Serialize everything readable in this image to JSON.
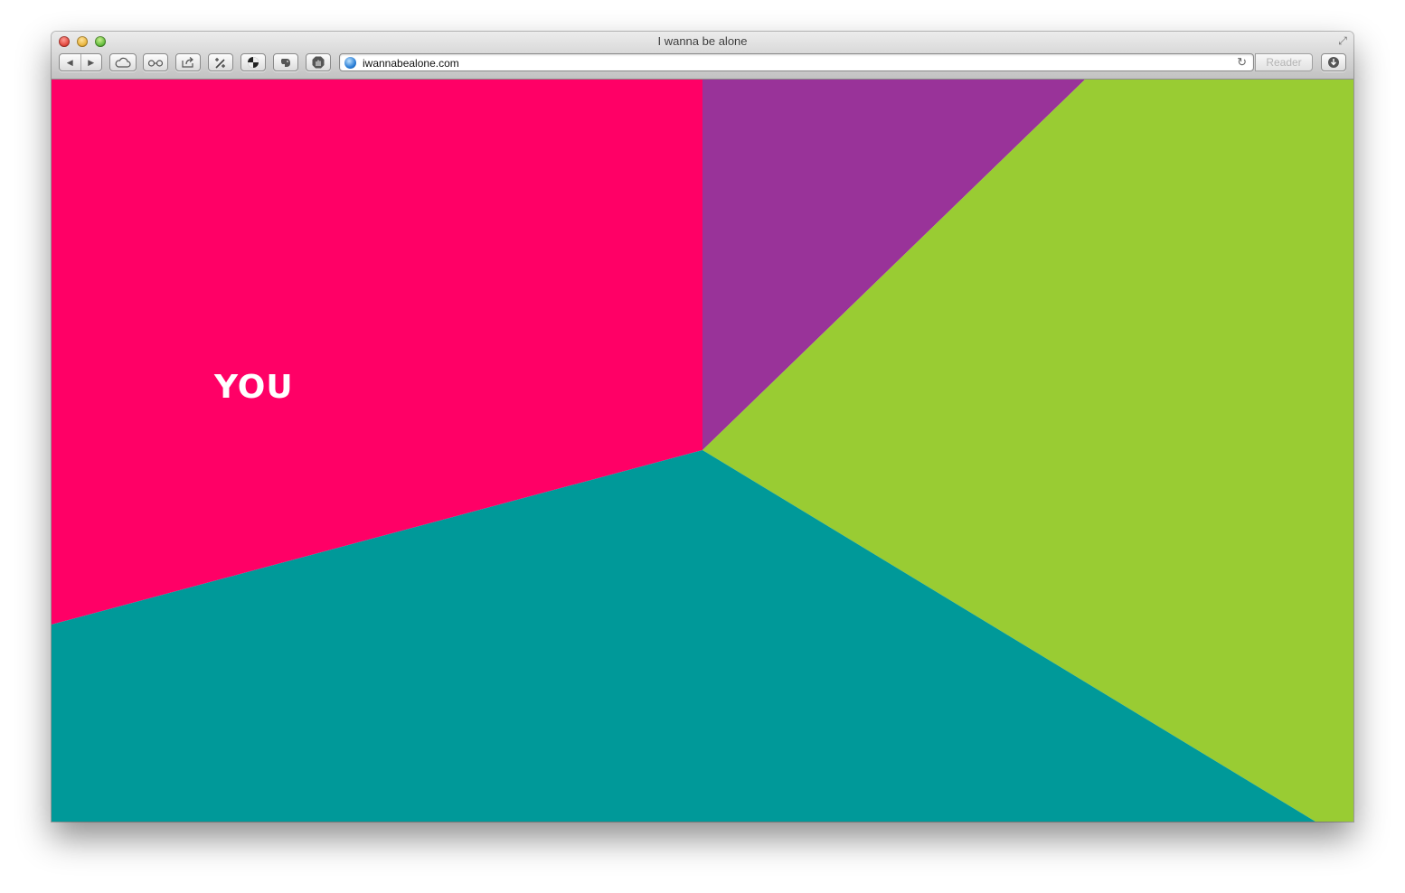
{
  "window": {
    "title": "I wanna be alone"
  },
  "toolbar": {
    "buttons": [
      {
        "name": "icloud-tabs",
        "icon": "cloud-icon"
      },
      {
        "name": "reading-list",
        "icon": "glasses-icon"
      },
      {
        "name": "share",
        "icon": "share-icon"
      },
      {
        "name": "extension-1",
        "icon": "wand-icon"
      },
      {
        "name": "extension-2",
        "icon": "aperture-icon"
      },
      {
        "name": "evernote",
        "icon": "elephant-icon"
      },
      {
        "name": "adblock",
        "icon": "stop-hand-icon"
      }
    ],
    "url": "iwannabealone.com",
    "reader_label": "Reader"
  },
  "page": {
    "label": "YOU",
    "colors": {
      "pink": "#ff0066",
      "purple": "#993399",
      "green": "#99cc33",
      "teal": "#009999"
    }
  }
}
